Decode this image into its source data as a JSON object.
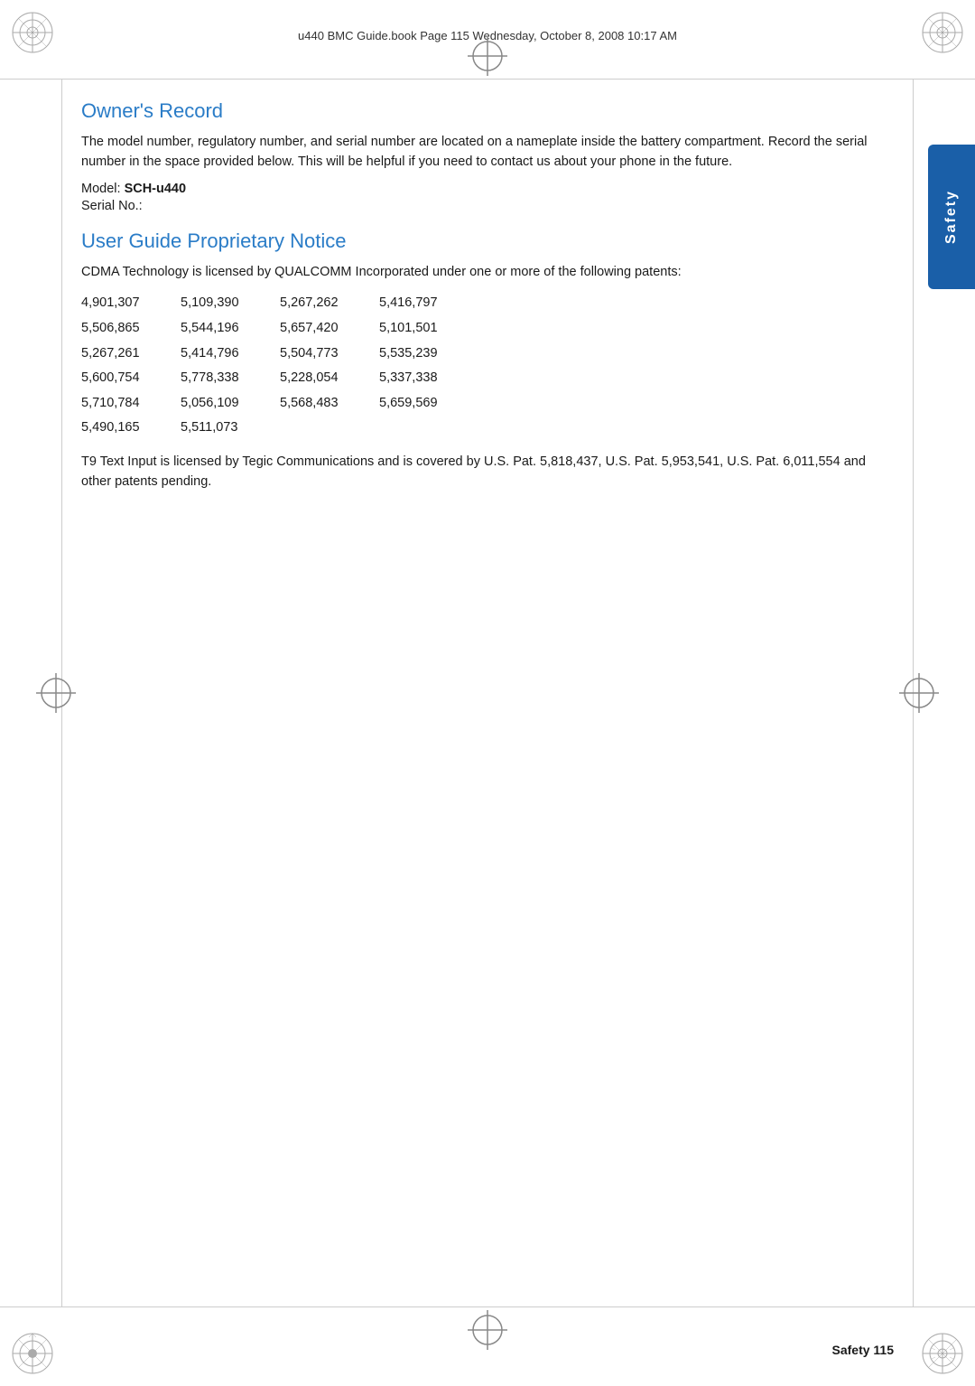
{
  "header": {
    "text": "u440 BMC Guide.book  Page 115  Wednesday, October 8, 2008  10:17 AM"
  },
  "footer": {
    "section_label": "Safety",
    "page_number": "115",
    "page_label": "Safety   115"
  },
  "safety_tab": {
    "label": "Safety"
  },
  "owners_record": {
    "title": "Owner's Record",
    "body": "The model number, regulatory number, and serial number are located on a nameplate inside the battery compartment. Record the serial number in the space provided below. This will be helpful if you need to contact us about your phone in the future.",
    "model_prefix": "Model: ",
    "model_value": "SCH-u440",
    "serial_prefix": "Serial No.:"
  },
  "user_guide": {
    "title": "User Guide Proprietary Notice",
    "body": "CDMA Technology is licensed by QUALCOMM Incorporated under one or more of the following patents:",
    "patents": [
      [
        "4,901,307",
        "5,109,390",
        "5,267,262",
        "5,416,797"
      ],
      [
        "5,506,865",
        "5,544,196",
        "5,657,420",
        "5,101,501"
      ],
      [
        "5,267,261",
        "5,414,796",
        "5,504,773",
        "5,535,239"
      ],
      [
        "5,600,754",
        "5,778,338",
        "5,228,054",
        "5,337,338"
      ],
      [
        "5,710,784",
        "5,056,109",
        "5,568,483",
        "5,659,569"
      ],
      [
        "5,490,165",
        "5,511,073",
        "",
        ""
      ]
    ],
    "t9_text": "T9 Text Input is licensed by Tegic Communications and is covered by U.S. Pat. 5,818,437, U.S. Pat. 5,953,541, U.S. Pat. 6,011,554 and other patents pending."
  }
}
